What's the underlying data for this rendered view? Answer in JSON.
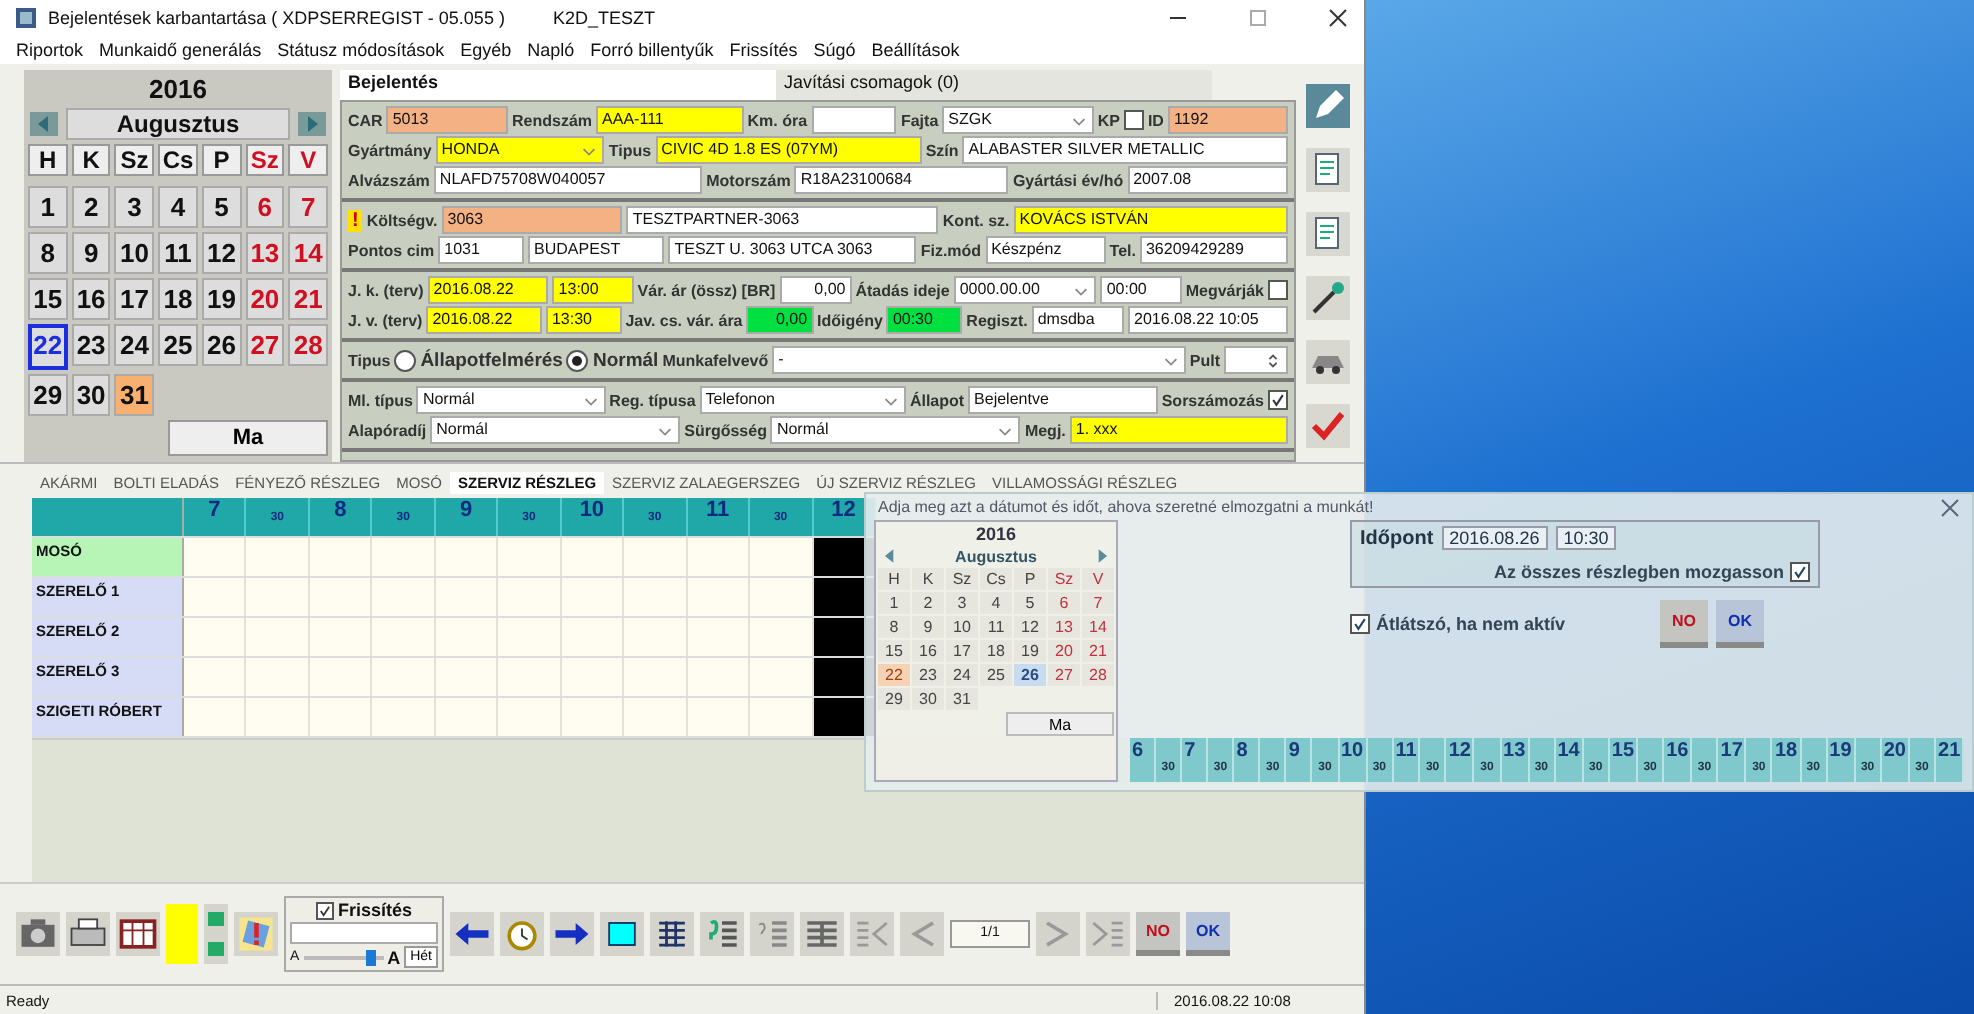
{
  "window": {
    "title": "Bejelentések karbantartása ( XDPSERREGIST - 05.055 )",
    "subtitle": "K2D_TESZT"
  },
  "menu": [
    "Riportok",
    "Munkaidő generálás",
    "Státusz módosítások",
    "Egyéb",
    "Napló",
    "Forró billentyűk",
    "Frissítés",
    "Súgó",
    "Beállítások"
  ],
  "calendar": {
    "year": "2016",
    "month": "Augusztus",
    "today_button": "Ma",
    "weekdays": [
      {
        "label": "H",
        "weekend": false
      },
      {
        "label": "K",
        "weekend": false
      },
      {
        "label": "Sz",
        "weekend": false
      },
      {
        "label": "Cs",
        "weekend": false
      },
      {
        "label": "P",
        "weekend": false
      },
      {
        "label": "Sz",
        "weekend": true
      },
      {
        "label": "V",
        "weekend": true
      }
    ],
    "days": [
      {
        "label": "1",
        "weekend": false,
        "selected": false,
        "marked": false
      },
      {
        "label": "2",
        "weekend": false,
        "selected": false,
        "marked": false
      },
      {
        "label": "3",
        "weekend": false,
        "selected": false,
        "marked": false
      },
      {
        "label": "4",
        "weekend": false,
        "selected": false,
        "marked": false
      },
      {
        "label": "5",
        "weekend": false,
        "selected": false,
        "marked": false
      },
      {
        "label": "6",
        "weekend": true,
        "selected": false,
        "marked": false
      },
      {
        "label": "7",
        "weekend": true,
        "selected": false,
        "marked": false
      },
      {
        "label": "8",
        "weekend": false,
        "selected": false,
        "marked": false
      },
      {
        "label": "9",
        "weekend": false,
        "selected": false,
        "marked": false
      },
      {
        "label": "10",
        "weekend": false,
        "selected": false,
        "marked": false
      },
      {
        "label": "11",
        "weekend": false,
        "selected": false,
        "marked": false
      },
      {
        "label": "12",
        "weekend": false,
        "selected": false,
        "marked": false
      },
      {
        "label": "13",
        "weekend": true,
        "selected": false,
        "marked": false
      },
      {
        "label": "14",
        "weekend": true,
        "selected": false,
        "marked": false
      },
      {
        "label": "15",
        "weekend": false,
        "selected": false,
        "marked": false
      },
      {
        "label": "16",
        "weekend": false,
        "selected": false,
        "marked": false
      },
      {
        "label": "17",
        "weekend": false,
        "selected": false,
        "marked": false
      },
      {
        "label": "18",
        "weekend": false,
        "selected": false,
        "marked": false
      },
      {
        "label": "19",
        "weekend": false,
        "selected": false,
        "marked": false
      },
      {
        "label": "20",
        "weekend": true,
        "selected": false,
        "marked": false
      },
      {
        "label": "21",
        "weekend": true,
        "selected": false,
        "marked": false
      },
      {
        "label": "22",
        "weekend": false,
        "selected": true,
        "marked": false
      },
      {
        "label": "23",
        "weekend": false,
        "selected": false,
        "marked": false
      },
      {
        "label": "24",
        "weekend": false,
        "selected": false,
        "marked": false
      },
      {
        "label": "25",
        "weekend": false,
        "selected": false,
        "marked": false
      },
      {
        "label": "26",
        "weekend": false,
        "selected": false,
        "marked": false
      },
      {
        "label": "27",
        "weekend": true,
        "selected": false,
        "marked": false
      },
      {
        "label": "28",
        "weekend": true,
        "selected": false,
        "marked": false
      },
      {
        "label": "29",
        "weekend": false,
        "selected": false,
        "marked": false
      },
      {
        "label": "30",
        "weekend": false,
        "selected": false,
        "marked": false
      },
      {
        "label": "31",
        "weekend": false,
        "selected": false,
        "marked": true
      }
    ]
  },
  "form": {
    "tabs": [
      {
        "label": "Bejelentés",
        "selected": true
      },
      {
        "label": "Javítási csomagok (0)",
        "selected": false
      }
    ],
    "sections": [
      {
        "rows": [
          {
            "items": [
              {
                "kind": "label",
                "text": "CAR"
              },
              {
                "kind": "field",
                "value": "5013",
                "color": "#f4b183"
              },
              {
                "kind": "label",
                "text": "Rendszám"
              },
              {
                "kind": "field",
                "value": "AAA-111",
                "color": "#ffff00"
              },
              {
                "kind": "label",
                "text": "Km. óra"
              },
              {
                "kind": "field"
              },
              {
                "kind": "label",
                "text": "Fajta"
              },
              {
                "kind": "select",
                "value": "SZGK"
              },
              {
                "kind": "label",
                "text": "KP"
              },
              {
                "kind": "check",
                "checked": false
              },
              {
                "kind": "label",
                "text": "ID"
              },
              {
                "kind": "field",
                "value": "1192",
                "color": "#f4b183"
              }
            ]
          },
          {
            "items": [
              {
                "kind": "label",
                "text": "Gyártmány"
              },
              {
                "kind": "select",
                "value": "HONDA",
                "color": "#ffff00"
              },
              {
                "kind": "label",
                "text": "Tipus"
              },
              {
                "kind": "field",
                "value": "CIVIC 4D 1.8 ES (07YM)",
                "color": "#ffff00"
              },
              {
                "kind": "label",
                "text": "Szín"
              },
              {
                "kind": "field",
                "value": "ALABASTER SILVER METALLIC"
              }
            ]
          },
          {
            "items": [
              {
                "kind": "label",
                "text": "Alvázszám"
              },
              {
                "kind": "field",
                "value": "NLAFD75708W040057"
              },
              {
                "kind": "label",
                "text": "Motorszám"
              },
              {
                "kind": "field",
                "value": "R18A23100684"
              },
              {
                "kind": "label",
                "text": "Gyártási év/hó"
              },
              {
                "kind": "field",
                "value": "2007.08"
              }
            ]
          }
        ]
      },
      {
        "rows": [
          {
            "items": [
              {
                "kind": "warn",
                "text": "!"
              },
              {
                "kind": "label",
                "text": "Költségv."
              },
              {
                "kind": "field",
                "value": "3063",
                "color": "#f4b183"
              },
              {
                "kind": "field",
                "value": "TESZTPARTNER-3063"
              },
              {
                "kind": "label",
                "text": "Kont. sz."
              },
              {
                "kind": "field",
                "value": "KOVÁCS ISTVÁN",
                "color": "#ffff00"
              }
            ]
          },
          {
            "items": [
              {
                "kind": "label",
                "text": "Pontos cim"
              },
              {
                "kind": "field",
                "value": "1031"
              },
              {
                "kind": "field",
                "value": "BUDAPEST"
              },
              {
                "kind": "field",
                "value": "TESZT U. 3063 UTCA 3063"
              },
              {
                "kind": "label",
                "text": "Fiz.mód"
              },
              {
                "kind": "field",
                "value": "Készpénz"
              },
              {
                "kind": "label",
                "text": "Tel."
              },
              {
                "kind": "field",
                "value": "36209429289"
              }
            ]
          }
        ]
      },
      {
        "rows": [
          {
            "items": [
              {
                "kind": "label",
                "text": "J. k. (terv)"
              },
              {
                "kind": "field",
                "value": "2016.08.22",
                "color": "#ffff00"
              },
              {
                "kind": "field",
                "value": "13:00",
                "color": "#ffff00"
              },
              {
                "kind": "label",
                "text": "Vár. ár (össz) [BR]"
              },
              {
                "kind": "number",
                "value": "0,00"
              },
              {
                "kind": "label",
                "text": "Átadás ideje"
              },
              {
                "kind": "select",
                "value": "0000.00.00"
              },
              {
                "kind": "field",
                "value": "00:00"
              },
              {
                "kind": "label",
                "text": "Megvárják"
              },
              {
                "kind": "check",
                "checked": false
              }
            ]
          },
          {
            "items": [
              {
                "kind": "label",
                "text": "J. v. (terv)"
              },
              {
                "kind": "field",
                "value": "2016.08.22",
                "color": "#ffff00"
              },
              {
                "kind": "field",
                "value": "13:30",
                "color": "#ffff00"
              },
              {
                "kind": "label",
                "text": "Jav. cs. vár. ára"
              },
              {
                "kind": "number",
                "value": "0,00",
                "color": "#00e040"
              },
              {
                "kind": "label",
                "text": "Időigény"
              },
              {
                "kind": "field",
                "value": "00:30",
                "color": "#00e040"
              },
              {
                "kind": "label",
                "text": "Regiszt."
              },
              {
                "kind": "field",
                "value": "dmsdba"
              },
              {
                "kind": "field",
                "value": "2016.08.22 10:05"
              }
            ]
          }
        ]
      },
      {
        "rows": [
          {
            "items": [
              {
                "kind": "label",
                "text": "Tipus"
              },
              {
                "kind": "radio",
                "text": "Állapotfelmérés",
                "selected": false
              },
              {
                "kind": "radio",
                "text": "Normál",
                "selected": true
              },
              {
                "kind": "label",
                "text": "Munkafelvevő"
              },
              {
                "kind": "select",
                "value": "-"
              },
              {
                "kind": "label",
                "text": "Pult"
              },
              {
                "kind": "spin"
              }
            ]
          }
        ]
      },
      {
        "rows": [
          {
            "items": [
              {
                "kind": "label",
                "text": "Ml. típus"
              },
              {
                "kind": "select",
                "value": "Normál"
              },
              {
                "kind": "label",
                "text": "Reg. típusa"
              },
              {
                "kind": "select",
                "value": "Telefonon"
              },
              {
                "kind": "label",
                "text": "Állapot"
              },
              {
                "kind": "field",
                "value": "Bejelentve"
              },
              {
                "kind": "label",
                "text": "Sorszámozás"
              },
              {
                "kind": "check",
                "checked": true
              }
            ]
          },
          {
            "items": [
              {
                "kind": "label",
                "text": "Alapóradíj"
              },
              {
                "kind": "select",
                "value": "Normál"
              },
              {
                "kind": "label",
                "text": "Sürgősség"
              },
              {
                "kind": "select",
                "value": "Normál"
              },
              {
                "kind": "label",
                "text": "Megj."
              },
              {
                "kind": "field",
                "value": "1. xxx",
                "color": "#ffff00"
              }
            ]
          }
        ]
      }
    ]
  },
  "schedule": {
    "tabs": [
      {
        "label": "AKÁRMI",
        "selected": false
      },
      {
        "label": "BOLTI ELADÁS",
        "selected": false
      },
      {
        "label": "FÉNYEZŐ RÉSZLEG",
        "selected": false
      },
      {
        "label": "MOSÓ",
        "selected": false
      },
      {
        "label": "SZERVIZ RÉSZLEG",
        "selected": true
      },
      {
        "label": "SZERVIZ ZALAEGERSZEG",
        "selected": false
      },
      {
        "label": "ÚJ SZERVIZ RÉSZLEG",
        "selected": false
      },
      {
        "label": "VILLAMOSSÁGI RÉSZLEG",
        "selected": false
      }
    ],
    "columns": [
      {
        "label": "7",
        "kind": "hour",
        "blocked": false
      },
      {
        "label": "30",
        "kind": "half",
        "blocked": false
      },
      {
        "label": "8",
        "kind": "hour",
        "blocked": false
      },
      {
        "label": "30",
        "kind": "half",
        "blocked": false
      },
      {
        "label": "9",
        "kind": "hour",
        "blocked": false
      },
      {
        "label": "30",
        "kind": "half",
        "blocked": false
      },
      {
        "label": "10",
        "kind": "hour",
        "blocked": false
      },
      {
        "label": "30",
        "kind": "half",
        "blocked": false
      },
      {
        "label": "11",
        "kind": "hour",
        "blocked": false
      },
      {
        "label": "30",
        "kind": "half",
        "blocked": false
      },
      {
        "label": "12",
        "kind": "hour",
        "blocked": true
      }
    ],
    "rows": [
      {
        "name": "MOSÓ",
        "color": "#b6f5b6"
      },
      {
        "name": "SZERELŐ 1",
        "color": "#d6dcf5"
      },
      {
        "name": "SZERELŐ 2",
        "color": "#d6dcf5"
      },
      {
        "name": "SZERELŐ 3",
        "color": "#d6dcf5"
      },
      {
        "name": "SZIGETI RÓBERT",
        "color": "#d6dcf5"
      }
    ]
  },
  "toolbar": {
    "refresh": {
      "label": "Frissítés",
      "checked": true
    },
    "zoom": {
      "small": "A",
      "large": "A",
      "level": 0.85
    },
    "week_button": "Hét",
    "page": "1/1",
    "no": "NO",
    "ok": "OK"
  },
  "status_bar": {
    "text": "Ready",
    "time": "2016.08.22 10:08"
  },
  "move_dialog": {
    "title": "Adja meg azt a dátumot és időt, ahova szeretné elmozgatni a munkát!",
    "calendar": {
      "year": "2016",
      "month": "Augusztus",
      "today_button": "Ma",
      "weekdays": [
        {
          "label": "H",
          "weekend": false
        },
        {
          "label": "K",
          "weekend": false
        },
        {
          "label": "Sz",
          "weekend": false
        },
        {
          "label": "Cs",
          "weekend": false
        },
        {
          "label": "P",
          "weekend": false
        },
        {
          "label": "Sz",
          "weekend": true
        },
        {
          "label": "V",
          "weekend": true
        }
      ],
      "days": [
        {
          "label": "1",
          "weekend": false,
          "selected": false,
          "marked": false
        },
        {
          "label": "2",
          "weekend": false,
          "selected": false,
          "marked": false
        },
        {
          "label": "3",
          "weekend": false,
          "selected": false,
          "marked": false
        },
        {
          "label": "4",
          "weekend": false,
          "selected": false,
          "marked": false
        },
        {
          "label": "5",
          "weekend": false,
          "selected": false,
          "marked": false
        },
        {
          "label": "6",
          "weekend": true,
          "selected": false,
          "marked": false
        },
        {
          "label": "7",
          "weekend": true,
          "selected": false,
          "marked": false
        },
        {
          "label": "8",
          "weekend": false,
          "selected": false,
          "marked": false
        },
        {
          "label": "9",
          "weekend": false,
          "selected": false,
          "marked": false
        },
        {
          "label": "10",
          "weekend": false,
          "selected": false,
          "marked": false
        },
        {
          "label": "11",
          "weekend": false,
          "selected": false,
          "marked": false
        },
        {
          "label": "12",
          "weekend": false,
          "selected": false,
          "marked": false
        },
        {
          "label": "13",
          "weekend": true,
          "selected": false,
          "marked": false
        },
        {
          "label": "14",
          "weekend": true,
          "selected": false,
          "marked": false
        },
        {
          "label": "15",
          "weekend": false,
          "selected": false,
          "marked": false
        },
        {
          "label": "16",
          "weekend": false,
          "selected": false,
          "marked": false
        },
        {
          "label": "17",
          "weekend": false,
          "selected": false,
          "marked": false
        },
        {
          "label": "18",
          "weekend": false,
          "selected": false,
          "marked": false
        },
        {
          "label": "19",
          "weekend": false,
          "selected": false,
          "marked": false
        },
        {
          "label": "20",
          "weekend": true,
          "selected": false,
          "marked": false
        },
        {
          "label": "21",
          "weekend": true,
          "selected": false,
          "marked": false
        },
        {
          "label": "22",
          "weekend": false,
          "selected": false,
          "marked": true
        },
        {
          "label": "23",
          "weekend": false,
          "selected": false,
          "marked": false
        },
        {
          "label": "24",
          "weekend": false,
          "selected": false,
          "marked": false
        },
        {
          "label": "25",
          "weekend": false,
          "selected": false,
          "marked": false
        },
        {
          "label": "26",
          "weekend": false,
          "selected": true,
          "marked": false
        },
        {
          "label": "27",
          "weekend": true,
          "selected": false,
          "marked": false
        },
        {
          "label": "28",
          "weekend": true,
          "selected": false,
          "marked": false
        },
        {
          "label": "29",
          "weekend": false,
          "selected": false,
          "marked": false
        },
        {
          "label": "30",
          "weekend": false,
          "selected": false,
          "marked": false
        },
        {
          "label": "31",
          "weekend": false,
          "selected": false,
          "marked": false
        }
      ]
    },
    "time_label": "Időpont",
    "date": "2016.08.26",
    "time": "10:30",
    "all_departments": {
      "label": "Az összes részlegben mozgasson",
      "checked": true
    },
    "transparent": {
      "label": "Átlátszó, ha nem aktív",
      "checked": true
    },
    "no": "NO",
    "ok": "OK",
    "timeline": [
      {
        "label": "6",
        "kind": "hour"
      },
      {
        "label": "30",
        "kind": "half"
      },
      {
        "label": "7",
        "kind": "hour"
      },
      {
        "label": "30",
        "kind": "half"
      },
      {
        "label": "8",
        "kind": "hour"
      },
      {
        "label": "30",
        "kind": "half"
      },
      {
        "label": "9",
        "kind": "hour"
      },
      {
        "label": "30",
        "kind": "half"
      },
      {
        "label": "10",
        "kind": "hour"
      },
      {
        "label": "30",
        "kind": "half"
      },
      {
        "label": "11",
        "kind": "hour"
      },
      {
        "label": "30",
        "kind": "half"
      },
      {
        "label": "12",
        "kind": "hour"
      },
      {
        "label": "30",
        "kind": "half"
      },
      {
        "label": "13",
        "kind": "hour"
      },
      {
        "label": "30",
        "kind": "half"
      },
      {
        "label": "14",
        "kind": "hour"
      },
      {
        "label": "30",
        "kind": "half"
      },
      {
        "label": "15",
        "kind": "hour"
      },
      {
        "label": "30",
        "kind": "half"
      },
      {
        "label": "16",
        "kind": "hour"
      },
      {
        "label": "30",
        "kind": "half"
      },
      {
        "label": "17",
        "kind": "hour"
      },
      {
        "label": "30",
        "kind": "half"
      },
      {
        "label": "18",
        "kind": "hour"
      },
      {
        "label": "30",
        "kind": "half"
      },
      {
        "label": "19",
        "kind": "hour"
      },
      {
        "label": "30",
        "kind": "half"
      },
      {
        "label": "20",
        "kind": "hour"
      },
      {
        "label": "30",
        "kind": "half"
      },
      {
        "label": "21",
        "kind": "hour"
      }
    ]
  }
}
